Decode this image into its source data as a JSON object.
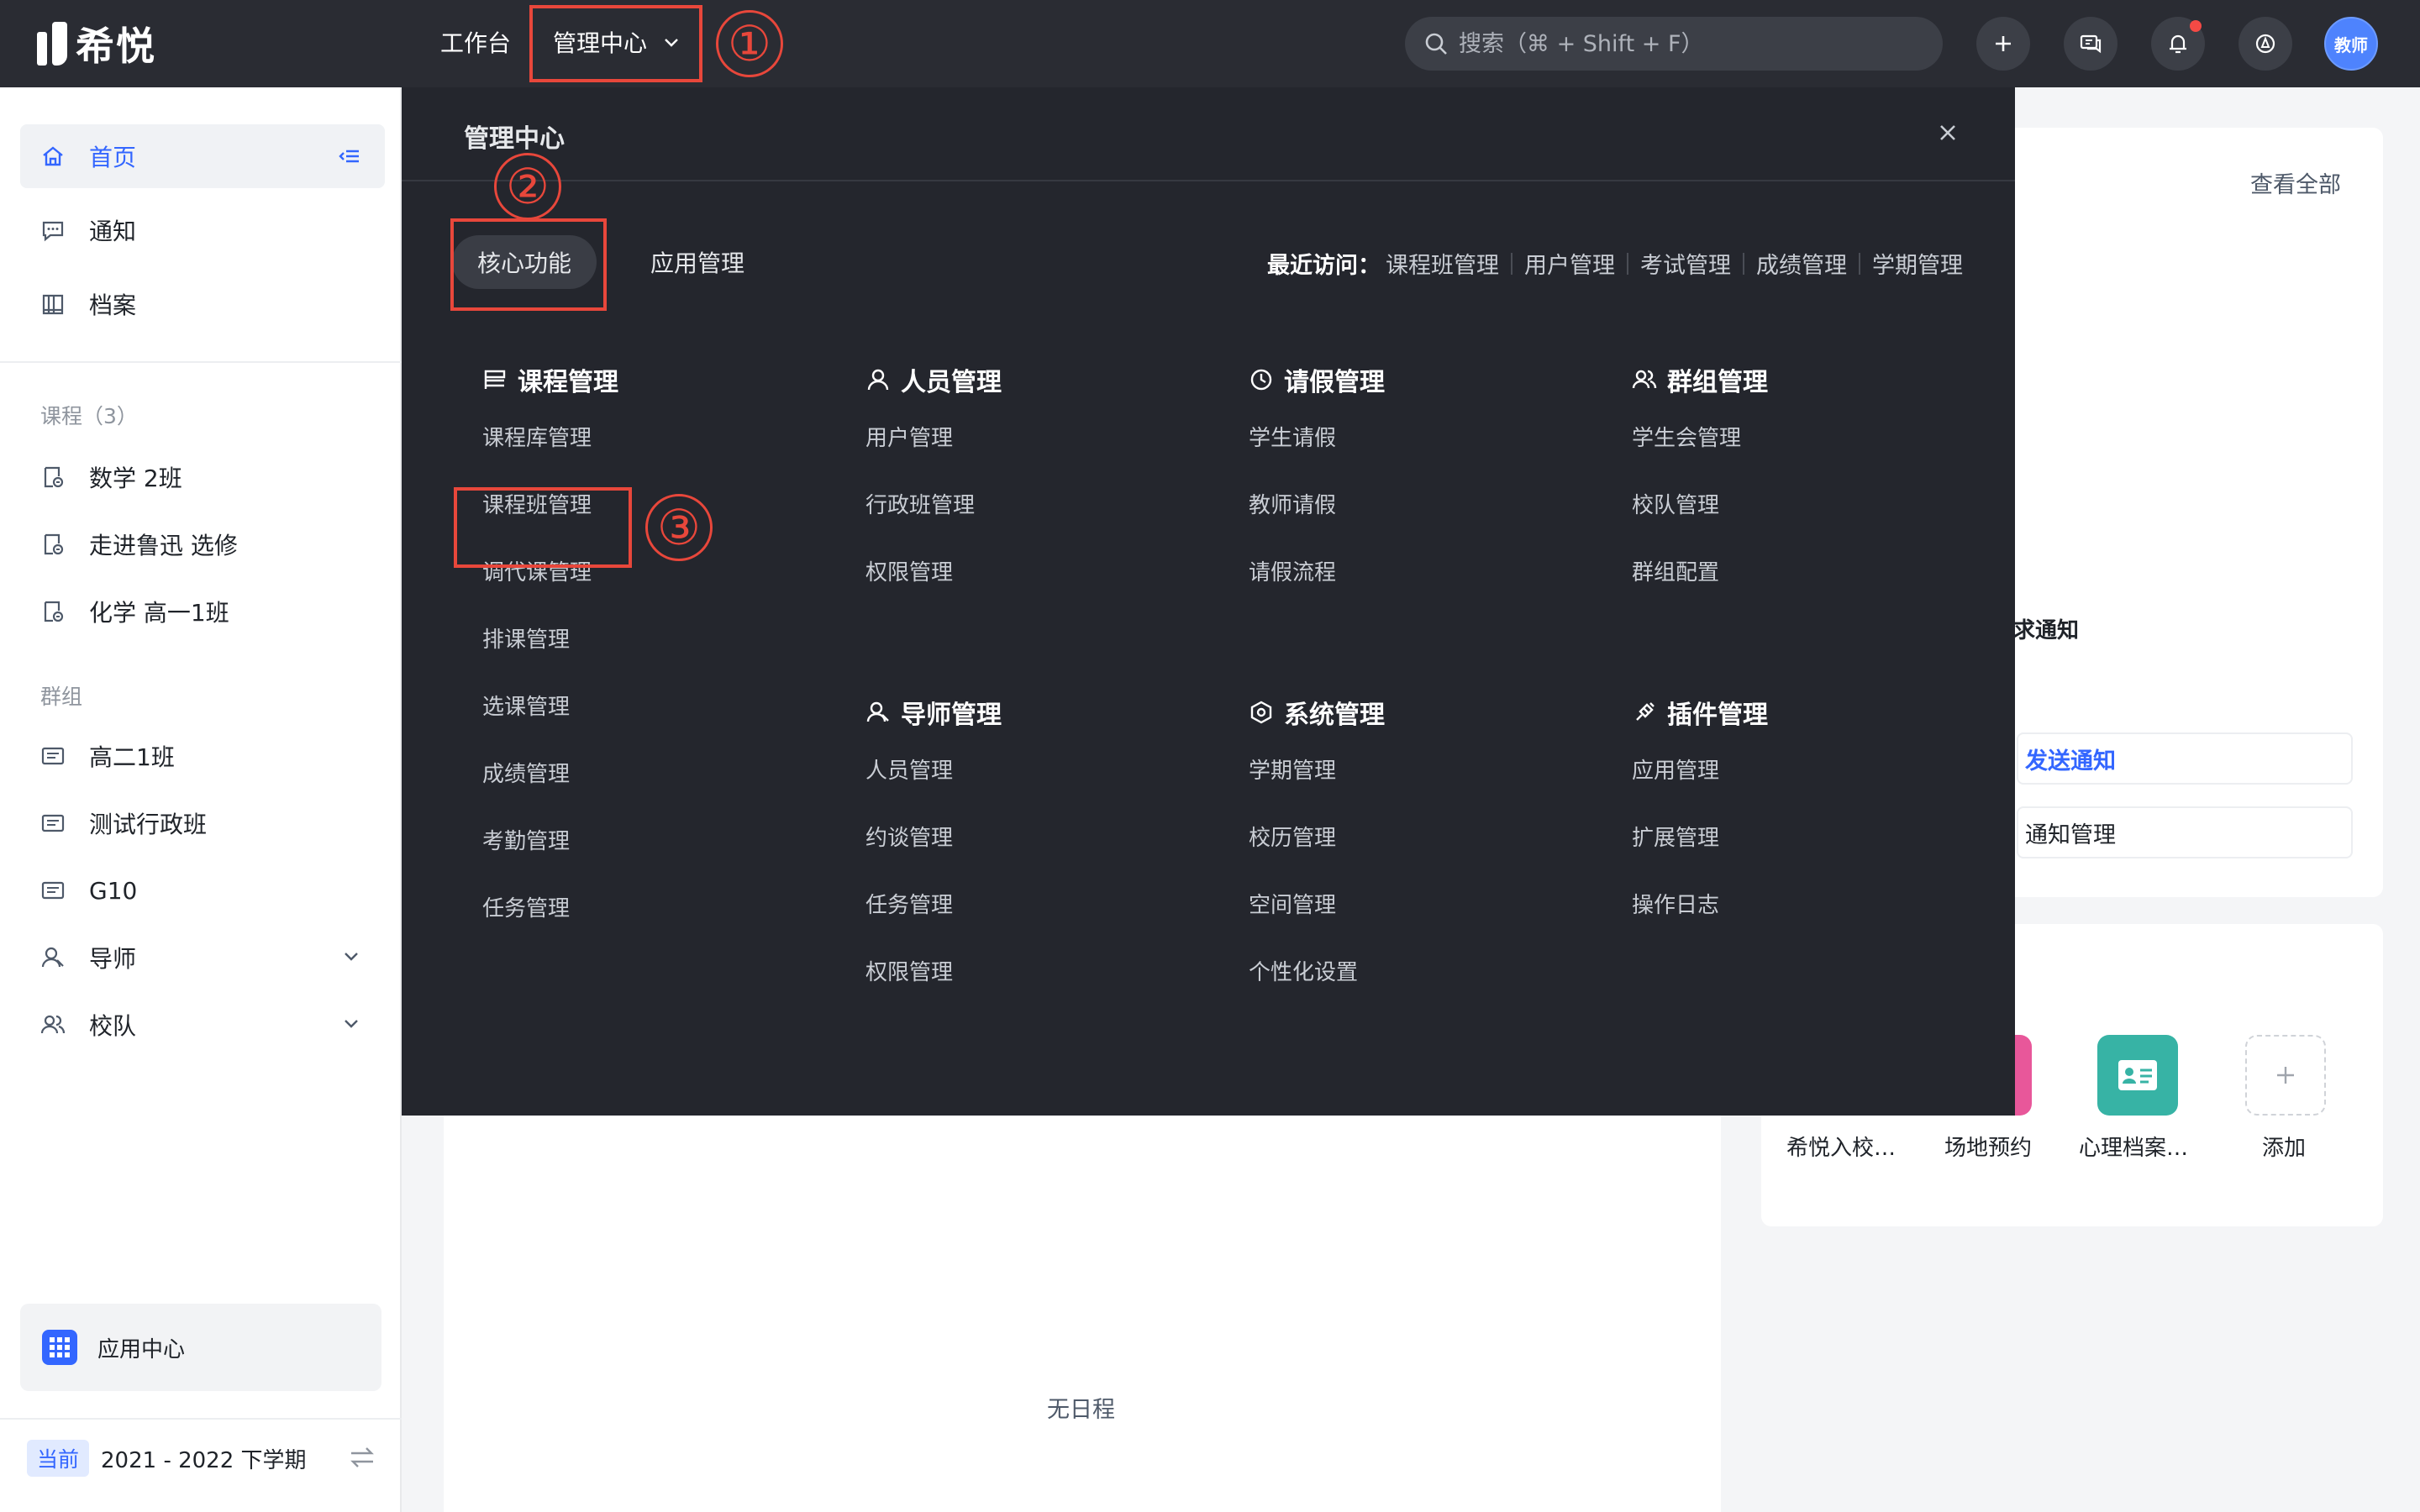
{
  "topbar": {
    "logo_text": "希悦",
    "nav_workbench": "工作台",
    "nav_admin": "管理中心",
    "search_placeholder": "搜索（⌘ + Shift + F）",
    "avatar_text": "教师"
  },
  "annotations": [
    "①",
    "②",
    "③"
  ],
  "sidebar": {
    "items_top": [
      {
        "label": "首页",
        "icon": "home-icon"
      },
      {
        "label": "通知",
        "icon": "message-icon"
      },
      {
        "label": "档案",
        "icon": "archive-icon"
      }
    ],
    "courses_heading": "课程（3）",
    "courses": [
      "数学 2班",
      "走进鲁迅 选修",
      "化学 高一1班"
    ],
    "groups_heading": "群组",
    "groups": [
      "高二1班",
      "测试行政班",
      "G10"
    ],
    "expandables": [
      "导师",
      "校队"
    ],
    "app_center": "应用中心",
    "term_tag": "当前",
    "term_label": "2021 - 2022 下学期"
  },
  "main": {
    "no_schedule": "无日程",
    "view_all": "查看全部",
    "notice_text": "求通知",
    "send_notice": "发送通知",
    "notice_manage": "通知管理",
    "apps": [
      "希悦入校…",
      "场地预约",
      "心理档案…",
      "添加"
    ]
  },
  "colors": {
    "topbar_bg": "#2a2c33",
    "overlay_bg": "#24262d",
    "accent": "#3366ff",
    "annotation": "#e8473b",
    "app_teal": "#37b3a5",
    "app_pink": "#e8579a"
  },
  "menu": {
    "title": "管理中心",
    "tabs": [
      "核心功能",
      "应用管理"
    ],
    "recent_label": "最近访问：",
    "recent": [
      "课程班管理",
      "用户管理",
      "考试管理",
      "成绩管理",
      "学期管理"
    ],
    "groups": [
      {
        "title": "课程管理",
        "icon": "course-icon",
        "items": [
          "课程库管理",
          "课程班管理",
          "调代课管理",
          "排课管理",
          "选课管理",
          "成绩管理",
          "考勤管理",
          "任务管理"
        ]
      },
      {
        "title": "人员管理",
        "icon": "user-icon",
        "items": [
          "用户管理",
          "行政班管理",
          "权限管理"
        ]
      },
      {
        "title": "请假管理",
        "icon": "clock-icon",
        "items": [
          "学生请假",
          "教师请假",
          "请假流程"
        ]
      },
      {
        "title": "群组管理",
        "icon": "group-icon",
        "items": [
          "学生会管理",
          "校队管理",
          "群组配置"
        ]
      },
      {
        "title": "导师管理",
        "icon": "mentor-icon",
        "items": [
          "人员管理",
          "约谈管理",
          "任务管理",
          "权限管理"
        ]
      },
      {
        "title": "系统管理",
        "icon": "system-icon",
        "items": [
          "学期管理",
          "校历管理",
          "空间管理",
          "个性化设置"
        ]
      },
      {
        "title": "插件管理",
        "icon": "plugin-icon",
        "items": [
          "应用管理",
          "扩展管理",
          "操作日志"
        ]
      }
    ]
  }
}
